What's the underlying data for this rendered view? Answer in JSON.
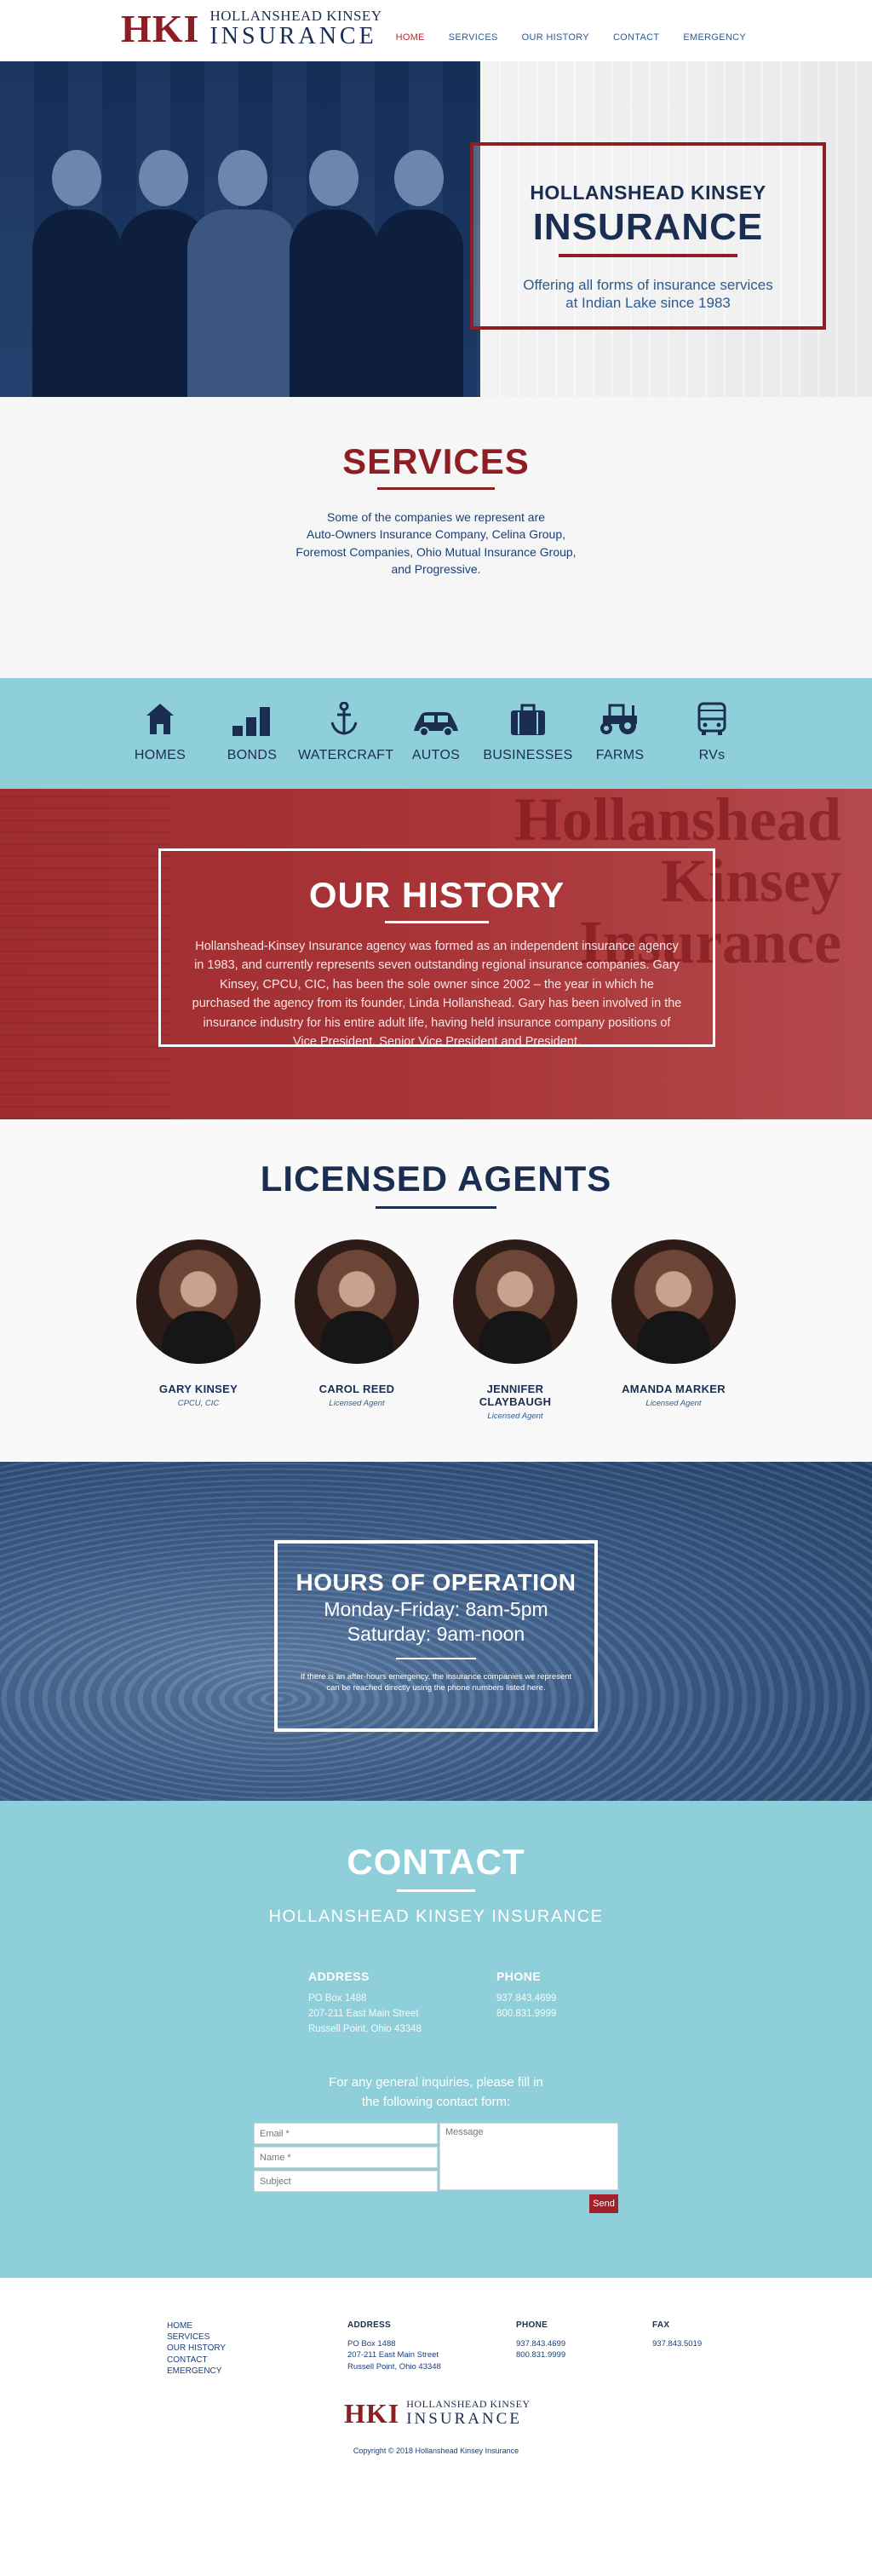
{
  "header": {
    "logo_mark": "HKI",
    "logo_top": "HOLLANSHEAD KINSEY",
    "logo_bottom": "INSURANCE",
    "nav": [
      "HOME",
      "SERVICES",
      "OUR HISTORY",
      "CONTACT",
      "EMERGENCY"
    ],
    "active_nav": "HOME"
  },
  "hero": {
    "line1": "HOLLANSHEAD KINSEY",
    "line2": "INSURANCE",
    "tagline_1": "Offering all forms of insurance services",
    "tagline_2": "at Indian Lake since 1983"
  },
  "services": {
    "title": "SERVICES",
    "desc_lines": [
      "Some of the companies we represent are",
      "Auto-Owners Insurance Company, Celina Group,",
      "Foremost Companies, Ohio Mutual Insurance Group,",
      "and Progressive."
    ],
    "items": [
      {
        "label": "HOMES",
        "icon": "home-icon"
      },
      {
        "label": "BONDS",
        "icon": "bar-chart-icon"
      },
      {
        "label": "WATERCRAFT",
        "icon": "anchor-icon"
      },
      {
        "label": "AUTOS",
        "icon": "car-icon"
      },
      {
        "label": "BUSINESSES",
        "icon": "briefcase-icon"
      },
      {
        "label": "FARMS",
        "icon": "tractor-icon"
      },
      {
        "label": "RVs",
        "icon": "bus-icon"
      }
    ]
  },
  "history": {
    "title": "OUR HISTORY",
    "body": "Hollanshead-Kinsey Insurance agency was formed as an independent insurance agency in 1983, and currently represents seven outstanding regional insurance companies. Gary Kinsey, CPCU, CIC, has been the sole owner since 2002 – the year in which he purchased the agency from its founder, Linda Hollanshead. Gary has been involved in the insurance industry for his entire adult life, having held insurance company positions of Vice President, Senior Vice President and President.",
    "wall_sign": [
      "Hollanshead",
      "Kinsey",
      "Insurance"
    ]
  },
  "agents": {
    "title": "LICENSED AGENTS",
    "list": [
      {
        "name": "GARY KINSEY",
        "role": "CPCU, CIC"
      },
      {
        "name": "CAROL REED",
        "role": "Licensed Agent"
      },
      {
        "name": "JENNIFER CLAYBAUGH",
        "role": "Licensed Agent"
      },
      {
        "name": "AMANDA MARKER",
        "role": "Licensed Agent"
      }
    ]
  },
  "hours": {
    "title": "HOURS OF OPERATION",
    "weekday": "Monday-Friday: 8am-5pm",
    "saturday": "Saturday: 9am-noon",
    "note": "If there is an after-hours emergency, the insurance companies we represent can be reached directly using the phone numbers listed here."
  },
  "contact": {
    "title": "CONTACT",
    "subtitle": "HOLLANSHEAD KINSEY INSURANCE",
    "address_label": "ADDRESS",
    "address_lines": [
      "PO Box 1488",
      "207-211 East Main Street",
      "Russell Point, Ohio 43348"
    ],
    "phone_label": "PHONE",
    "phone_lines": [
      "937.843.4699",
      "800.831.9999"
    ],
    "prompt_1": "For any general inquiries, please fill in",
    "prompt_2": "the following contact form:",
    "form": {
      "email_placeholder": "Email *",
      "name_placeholder": "Name *",
      "subject_placeholder": "Subject",
      "message_placeholder": "Message",
      "send_label": "Send"
    }
  },
  "footer": {
    "links": [
      "HOME",
      "SERVICES",
      "OUR HISTORY",
      "CONTACT",
      "EMERGENCY"
    ],
    "address_label": "ADDRESS",
    "address_lines": [
      "PO Box 1488",
      "207-211 East Main Street",
      "Russell Point, Ohio 43348"
    ],
    "phone_label": "PHONE",
    "phone_lines": [
      "937.843.4699",
      "800.831.9999"
    ],
    "fax_label": "FAX",
    "fax_lines": [
      "937.843.5019"
    ],
    "copyright": "Copyright © 2018 Hollanshead Kinsey Insurance"
  },
  "colors": {
    "brand_red": "#8f1d24",
    "navy": "#1a2e52",
    "teal": "#8ecfd9",
    "link_blue": "#2e5a8f"
  }
}
